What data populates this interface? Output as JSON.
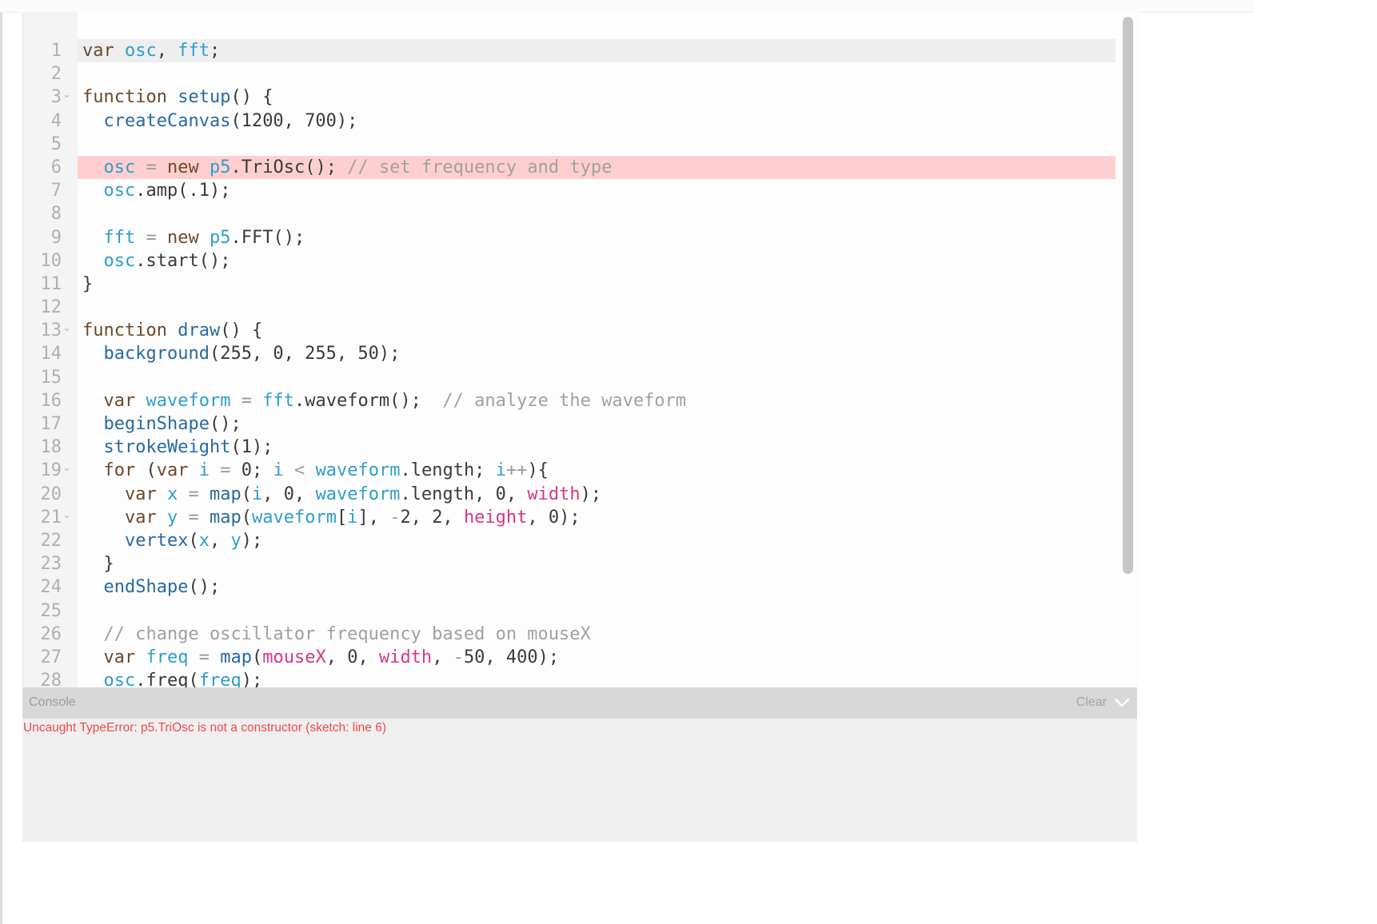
{
  "editor": {
    "lines": [
      {
        "num": "1",
        "fold": false,
        "state": "active",
        "tokens": [
          {
            "t": "var",
            "c": "kw"
          },
          {
            "t": " ",
            "c": "p"
          },
          {
            "t": "osc",
            "c": "var"
          },
          {
            "t": ", ",
            "c": "p"
          },
          {
            "t": "fft",
            "c": "var"
          },
          {
            "t": ";",
            "c": "p"
          }
        ]
      },
      {
        "num": "2",
        "fold": false,
        "state": "",
        "tokens": []
      },
      {
        "num": "3",
        "fold": true,
        "state": "",
        "tokens": [
          {
            "t": "function",
            "c": "kw"
          },
          {
            "t": " ",
            "c": "p"
          },
          {
            "t": "setup",
            "c": "fn"
          },
          {
            "t": "() {",
            "c": "p"
          }
        ]
      },
      {
        "num": "4",
        "fold": false,
        "state": "",
        "tokens": [
          {
            "t": "  ",
            "c": "p"
          },
          {
            "t": "createCanvas",
            "c": "fn"
          },
          {
            "t": "(1200, 700);",
            "c": "p"
          }
        ]
      },
      {
        "num": "5",
        "fold": false,
        "state": "",
        "tokens": []
      },
      {
        "num": "6",
        "fold": false,
        "state": "error",
        "tokens": [
          {
            "t": "  ",
            "c": "p"
          },
          {
            "t": "osc",
            "c": "var"
          },
          {
            "t": " = ",
            "c": "op"
          },
          {
            "t": "new",
            "c": "kw"
          },
          {
            "t": " ",
            "c": "p"
          },
          {
            "t": "p5",
            "c": "var"
          },
          {
            "t": ".TriOsc(); ",
            "c": "p"
          },
          {
            "t": "// set frequency and type",
            "c": "cm"
          }
        ]
      },
      {
        "num": "7",
        "fold": false,
        "state": "",
        "tokens": [
          {
            "t": "  ",
            "c": "p"
          },
          {
            "t": "osc",
            "c": "var"
          },
          {
            "t": ".amp(.1);",
            "c": "p"
          }
        ]
      },
      {
        "num": "8",
        "fold": false,
        "state": "",
        "tokens": []
      },
      {
        "num": "9",
        "fold": false,
        "state": "",
        "tokens": [
          {
            "t": "  ",
            "c": "p"
          },
          {
            "t": "fft",
            "c": "var"
          },
          {
            "t": " = ",
            "c": "op"
          },
          {
            "t": "new",
            "c": "kw"
          },
          {
            "t": " ",
            "c": "p"
          },
          {
            "t": "p5",
            "c": "var"
          },
          {
            "t": ".FFT();",
            "c": "p"
          }
        ]
      },
      {
        "num": "10",
        "fold": false,
        "state": "",
        "tokens": [
          {
            "t": "  ",
            "c": "p"
          },
          {
            "t": "osc",
            "c": "var"
          },
          {
            "t": ".start();",
            "c": "p"
          }
        ]
      },
      {
        "num": "11",
        "fold": false,
        "state": "",
        "tokens": [
          {
            "t": "}",
            "c": "p"
          }
        ]
      },
      {
        "num": "12",
        "fold": false,
        "state": "",
        "tokens": []
      },
      {
        "num": "13",
        "fold": true,
        "state": "",
        "tokens": [
          {
            "t": "function",
            "c": "kw"
          },
          {
            "t": " ",
            "c": "p"
          },
          {
            "t": "draw",
            "c": "fn"
          },
          {
            "t": "() {",
            "c": "p"
          }
        ]
      },
      {
        "num": "14",
        "fold": false,
        "state": "",
        "tokens": [
          {
            "t": "  ",
            "c": "p"
          },
          {
            "t": "background",
            "c": "fn"
          },
          {
            "t": "(255, 0, 255, 50);",
            "c": "p"
          }
        ]
      },
      {
        "num": "15",
        "fold": false,
        "state": "",
        "tokens": []
      },
      {
        "num": "16",
        "fold": false,
        "state": "",
        "tokens": [
          {
            "t": "  ",
            "c": "p"
          },
          {
            "t": "var",
            "c": "kw"
          },
          {
            "t": " ",
            "c": "p"
          },
          {
            "t": "waveform",
            "c": "var"
          },
          {
            "t": " = ",
            "c": "op"
          },
          {
            "t": "fft",
            "c": "var"
          },
          {
            "t": ".waveform();  ",
            "c": "p"
          },
          {
            "t": "// analyze the waveform",
            "c": "cm"
          }
        ]
      },
      {
        "num": "17",
        "fold": false,
        "state": "",
        "tokens": [
          {
            "t": "  ",
            "c": "p"
          },
          {
            "t": "beginShape",
            "c": "fn"
          },
          {
            "t": "();",
            "c": "p"
          }
        ]
      },
      {
        "num": "18",
        "fold": false,
        "state": "",
        "tokens": [
          {
            "t": "  ",
            "c": "p"
          },
          {
            "t": "strokeWeight",
            "c": "fn"
          },
          {
            "t": "(1);",
            "c": "p"
          }
        ]
      },
      {
        "num": "19",
        "fold": true,
        "state": "",
        "tokens": [
          {
            "t": "  ",
            "c": "p"
          },
          {
            "t": "for",
            "c": "kw"
          },
          {
            "t": " (",
            "c": "p"
          },
          {
            "t": "var",
            "c": "kw"
          },
          {
            "t": " ",
            "c": "p"
          },
          {
            "t": "i",
            "c": "var"
          },
          {
            "t": " = ",
            "c": "op"
          },
          {
            "t": "0; ",
            "c": "p"
          },
          {
            "t": "i",
            "c": "var"
          },
          {
            "t": " < ",
            "c": "op"
          },
          {
            "t": "waveform",
            "c": "var"
          },
          {
            "t": ".length; ",
            "c": "p"
          },
          {
            "t": "i",
            "c": "var"
          },
          {
            "t": "++",
            "c": "op"
          },
          {
            "t": "){",
            "c": "p"
          }
        ]
      },
      {
        "num": "20",
        "fold": false,
        "state": "",
        "tokens": [
          {
            "t": "    ",
            "c": "p"
          },
          {
            "t": "var",
            "c": "kw"
          },
          {
            "t": " ",
            "c": "p"
          },
          {
            "t": "x",
            "c": "var"
          },
          {
            "t": " = ",
            "c": "op"
          },
          {
            "t": "map",
            "c": "fn"
          },
          {
            "t": "(",
            "c": "p"
          },
          {
            "t": "i",
            "c": "var"
          },
          {
            "t": ", 0, ",
            "c": "p"
          },
          {
            "t": "waveform",
            "c": "var"
          },
          {
            "t": ".length, 0, ",
            "c": "p"
          },
          {
            "t": "width",
            "c": "pk"
          },
          {
            "t": ");",
            "c": "p"
          }
        ]
      },
      {
        "num": "21",
        "fold": true,
        "state": "",
        "tokens": [
          {
            "t": "    ",
            "c": "p"
          },
          {
            "t": "var",
            "c": "kw"
          },
          {
            "t": " ",
            "c": "p"
          },
          {
            "t": "y",
            "c": "var"
          },
          {
            "t": " = ",
            "c": "op"
          },
          {
            "t": "map",
            "c": "fn"
          },
          {
            "t": "(",
            "c": "p"
          },
          {
            "t": "waveform",
            "c": "var"
          },
          {
            "t": "[",
            "c": "p"
          },
          {
            "t": "i",
            "c": "var"
          },
          {
            "t": "], ",
            "c": "p"
          },
          {
            "t": "-",
            "c": "op"
          },
          {
            "t": "2, 2, ",
            "c": "p"
          },
          {
            "t": "height",
            "c": "pk"
          },
          {
            "t": ", 0);",
            "c": "p"
          }
        ]
      },
      {
        "num": "22",
        "fold": false,
        "state": "",
        "tokens": [
          {
            "t": "    ",
            "c": "p"
          },
          {
            "t": "vertex",
            "c": "fn"
          },
          {
            "t": "(",
            "c": "p"
          },
          {
            "t": "x",
            "c": "var"
          },
          {
            "t": ", ",
            "c": "p"
          },
          {
            "t": "y",
            "c": "var"
          },
          {
            "t": ");",
            "c": "p"
          }
        ]
      },
      {
        "num": "23",
        "fold": false,
        "state": "",
        "tokens": [
          {
            "t": "  }",
            "c": "p"
          }
        ]
      },
      {
        "num": "24",
        "fold": false,
        "state": "",
        "tokens": [
          {
            "t": "  ",
            "c": "p"
          },
          {
            "t": "endShape",
            "c": "fn"
          },
          {
            "t": "();",
            "c": "p"
          }
        ]
      },
      {
        "num": "25",
        "fold": false,
        "state": "",
        "tokens": []
      },
      {
        "num": "26",
        "fold": false,
        "state": "",
        "tokens": [
          {
            "t": "  ",
            "c": "p"
          },
          {
            "t": "// change oscillator frequency based on mouseX",
            "c": "cm"
          }
        ]
      },
      {
        "num": "27",
        "fold": false,
        "state": "",
        "tokens": [
          {
            "t": "  ",
            "c": "p"
          },
          {
            "t": "var",
            "c": "kw"
          },
          {
            "t": " ",
            "c": "p"
          },
          {
            "t": "freq",
            "c": "var"
          },
          {
            "t": " = ",
            "c": "op"
          },
          {
            "t": "map",
            "c": "fn"
          },
          {
            "t": "(",
            "c": "p"
          },
          {
            "t": "mouseX",
            "c": "pk"
          },
          {
            "t": ", 0, ",
            "c": "p"
          },
          {
            "t": "width",
            "c": "pk"
          },
          {
            "t": ", ",
            "c": "p"
          },
          {
            "t": "-",
            "c": "op"
          },
          {
            "t": "50, 400);",
            "c": "p"
          }
        ]
      },
      {
        "num": "28",
        "fold": false,
        "state": "",
        "tokens": [
          {
            "t": "  ",
            "c": "p"
          },
          {
            "t": "osc",
            "c": "var"
          },
          {
            "t": ".freq(",
            "c": "p"
          },
          {
            "t": "freq",
            "c": "var"
          },
          {
            "t": ");",
            "c": "p"
          }
        ]
      }
    ]
  },
  "console": {
    "title": "Console",
    "clear_label": "Clear",
    "collapse_icon": "chevron-down-icon",
    "messages": [
      {
        "text": "Uncaught TypeError: p5.TriOsc is not a constructor (sketch: line 6)",
        "level": "error"
      }
    ]
  },
  "colors": {
    "keyword": "#6c4a2a",
    "variable": "#2e9ecd",
    "function": "#286aa0",
    "builtin": "#d8368c",
    "comment": "#a0a0a0",
    "error_line_bg": "#ffcfcf",
    "error_text": "#ef4a4a"
  }
}
